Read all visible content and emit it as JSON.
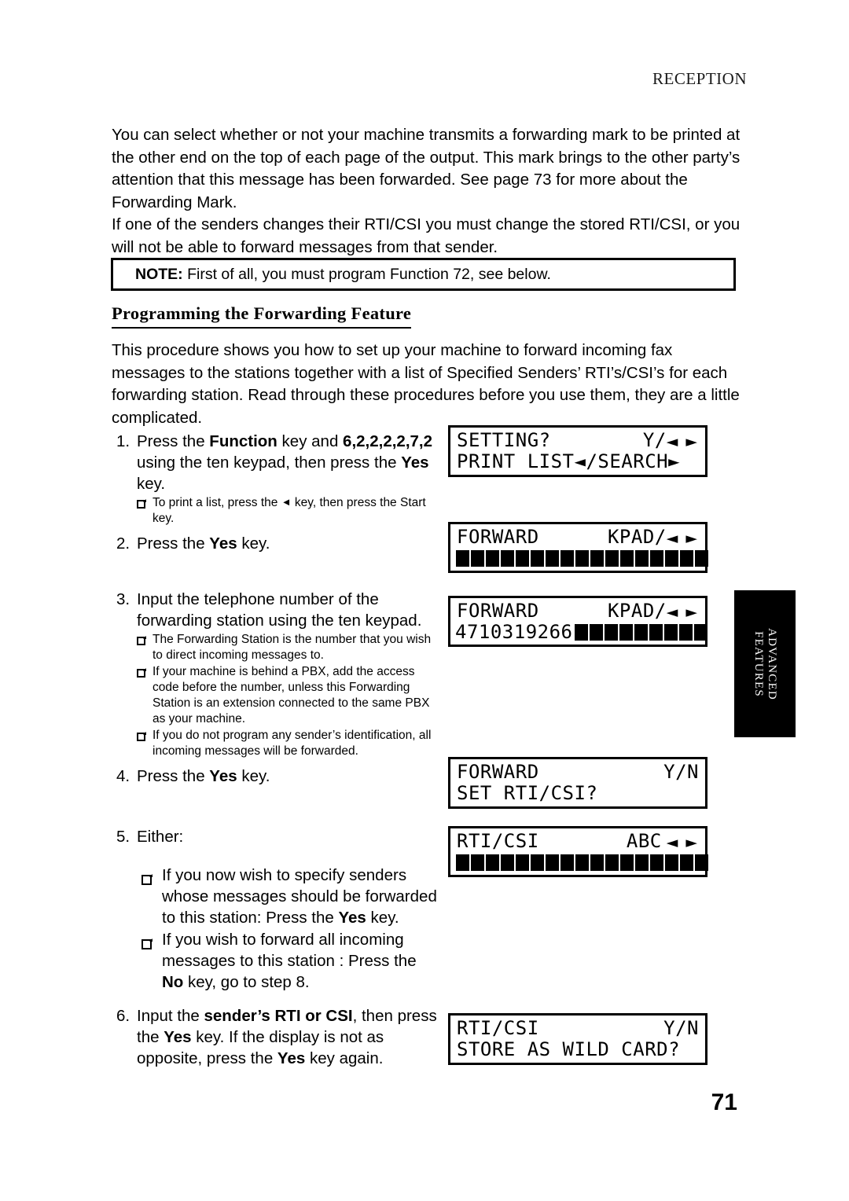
{
  "page": {
    "running_head": "RECEPTION",
    "page_number": "71"
  },
  "intro": {
    "p1": "You can select whether or not your machine transmits a forwarding mark to be printed at the other end on the top of each page of the output. This mark brings to the other party’s attention that this message has been forwarded. See page 73 for more about the Forwarding Mark.",
    "p2": "If one of the senders changes their RTI/CSI you must change the stored RTI/CSI, or you will not be able to forward messages from that sender."
  },
  "note": {
    "label": "NOTE:",
    "text": " First of all, you must program Function 72, see below."
  },
  "section": {
    "heading": "Programming the Forwarding Feature",
    "intro": "This procedure shows you how to set up your machine to forward incoming fax messages to the stations together with a list of Specified Senders’ RTI’s/CSI’s for each forwarding station. Read through these procedures before you use them, they are a little complicated."
  },
  "steps": [
    {
      "num": "1.",
      "text_a": "Press the ",
      "bold_a": "Function",
      "text_b": " key and ",
      "bold_b": "6,2,2,2,2,7,2",
      "text_c": " using the ten keypad, then press the ",
      "bold_c": "Yes",
      "text_d": " key.",
      "subs": [
        {
          "pre": "To print a list, press the ",
          "arrow": "◄",
          "post": " key, then press the Start key."
        }
      ]
    },
    {
      "num": "2.",
      "text_a": "Press the ",
      "bold_a": "Yes",
      "text_b": " key.",
      "subs": []
    },
    {
      "num": "3.",
      "text_a": "Input the telephone number of the forwarding station using the ten keypad.",
      "subs": [
        {
          "text": "The Forwarding Station is the number that you wish to direct incoming messages to."
        },
        {
          "text": "If your machine is behind a PBX, add the access code before the number, unless this Forwarding Station is an extension connected to the same PBX as your machine."
        },
        {
          "text": "If you do not program any sender’s identification, all incoming messages will be forwarded."
        }
      ]
    },
    {
      "num": "4.",
      "text_a": "Press the ",
      "bold_a": "Yes",
      "text_b": " key.",
      "subs": []
    },
    {
      "num": "5.",
      "text_a": "Either:",
      "subs": [
        {
          "pre": "If you now wish to specify senders whose messages should be forwarded to this station: Press the ",
          "bold": "Yes",
          "post": " key."
        },
        {
          "pre": "If you wish to forward all incoming messages to this station : Press the ",
          "bold": "No",
          "post": " key, go to step 8."
        }
      ]
    },
    {
      "num": "6.",
      "text_a": "Input the ",
      "bold_a": "sender’s RTI or CSI",
      "text_b": ", then press the ",
      "bold_b": "Yes",
      "text_c": " key. If the display is not as opposite, press the ",
      "bold_c": "Yes",
      "text_d": " key again.",
      "subs": []
    }
  ],
  "displays": [
    {
      "id": "display-setting-print-list",
      "line1_left": "SETTING?",
      "line1_right": "Y/",
      "line1_arrows": "◄ ►",
      "line2_left": "PRINT LIST◄/SEARCH►",
      "line2_right": "",
      "blocks": 0
    },
    {
      "id": "display-forward-kpad-empty",
      "line1_left": "FORWARD",
      "line1_right": "KPAD/",
      "line1_arrows": "◄ ►",
      "line2_left": "",
      "blocks": 17
    },
    {
      "id": "display-forward-kpad-number",
      "line1_left": "FORWARD",
      "line1_right": "KPAD/",
      "line1_arrows": "◄ ►",
      "line2_digits": "4710319266",
      "blocks": 9
    },
    {
      "id": "display-forward-set-rti-csi",
      "line1_left": "FORWARD",
      "line1_right": "Y/N",
      "line1_arrows": "",
      "line2_left": "SET RTI/CSI?",
      "blocks": 0
    },
    {
      "id": "display-rti-csi-abc",
      "line1_left": "RTI/CSI",
      "line1_right": "ABC",
      "line1_arrows": "◄ ►",
      "line2_left": "",
      "blocks": 17
    },
    {
      "id": "display-rti-csi-wild-card",
      "line1_left": "RTI/CSI",
      "line1_right": "Y/N",
      "line1_arrows": "",
      "line2_left": "STORE AS WILD CARD?",
      "blocks": 0
    }
  ],
  "side_tab": {
    "line1": "ADVANCED",
    "line2": "FEATURES"
  }
}
